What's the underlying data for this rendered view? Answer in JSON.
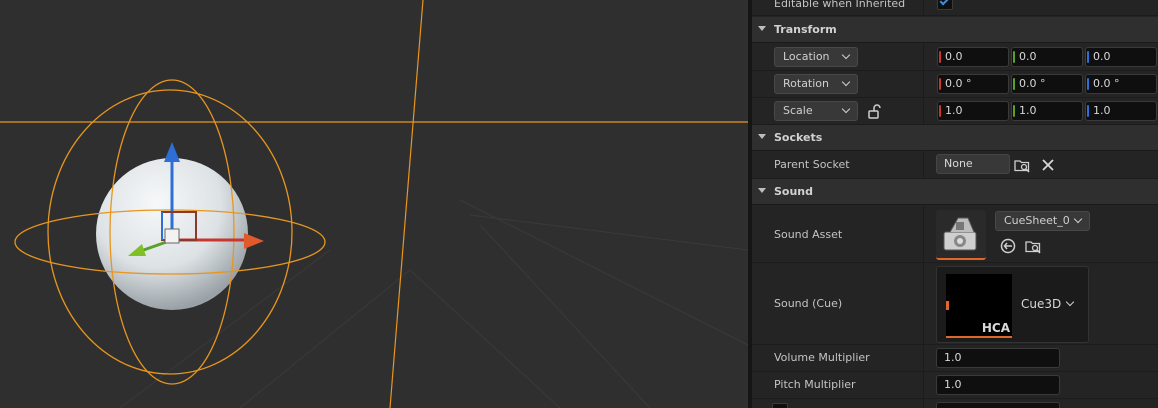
{
  "details": {
    "editable_inherited": {
      "label": "Editable when Inherited",
      "checked": true
    },
    "transform": {
      "title": "Transform",
      "location": {
        "mode": "Location",
        "x": "0.0",
        "y": "0.0",
        "z": "0.0"
      },
      "rotation": {
        "mode": "Rotation",
        "x": "0.0 °",
        "y": "0.0 °",
        "z": "0.0 °"
      },
      "scale": {
        "mode": "Scale",
        "x": "1.0",
        "y": "1.0",
        "z": "1.0"
      }
    },
    "sockets": {
      "title": "Sockets",
      "parent_socket_label": "Parent Socket",
      "parent_socket_value": "None"
    },
    "sound": {
      "title": "Sound",
      "sound_asset_label": "Sound Asset",
      "sound_asset_value": "CueSheet_0",
      "sound_cue_label": "Sound (Cue)",
      "sound_cue_value": "Cue3D",
      "sound_cue_thumb_text": "HCA",
      "volume_label": "Volume Multiplier",
      "volume_value": "1.0",
      "pitch_label": "Pitch Multiplier",
      "pitch_value": "1.0"
    }
  },
  "colors": {
    "axis_x": "#c8372e",
    "axis_y": "#5aa02c",
    "axis_z": "#2d6fd6",
    "selection": "#e8961e",
    "checkbox": "#3c8fe0"
  },
  "icons": [
    "unlock-icon",
    "browse-icon",
    "clear-icon",
    "use-selected-icon",
    "sound-asset-icon",
    "transform-gizmo"
  ]
}
